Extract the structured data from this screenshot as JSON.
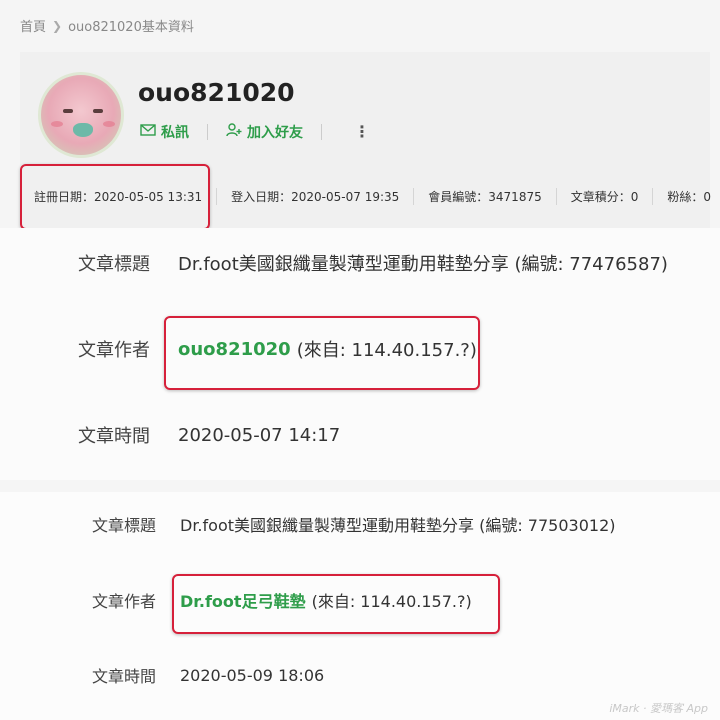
{
  "breadcrumb": {
    "home": "首頁",
    "current": "ouo821020基本資料"
  },
  "profile": {
    "username": "ouo821020",
    "message_label": "私訊",
    "add_friend_label": "加入好友",
    "stats": {
      "register": "註冊日期：2020-05-05 13:31",
      "login": "登入日期：2020-05-07 19:35",
      "member_no": "會員編號：3471875",
      "points": "文章積分：0",
      "fans": "粉絲：0"
    }
  },
  "post1": {
    "title_label": "文章標題",
    "title": "Dr.foot美國銀纖量製薄型運動用鞋墊分享 (編號: 77476587)",
    "author_label": "文章作者",
    "author": "ouo821020",
    "author_from": "(來自: 114.40.157.?)",
    "time_label": "文章時間",
    "time": "2020-05-07 14:17"
  },
  "post2": {
    "title_label": "文章標題",
    "title": "Dr.foot美國銀纖量製薄型運動用鞋墊分享 (編號: 77503012)",
    "author_label": "文章作者",
    "author": "Dr.foot足弓鞋墊",
    "author_from": "(來自: 114.40.157.?)",
    "time_label": "文章時間",
    "time": "2020-05-09 18:06"
  },
  "watermark": "iMark · 愛瑪客 App",
  "colors": {
    "accent_green": "#2e9d4a",
    "highlight_red": "#d6203a"
  }
}
